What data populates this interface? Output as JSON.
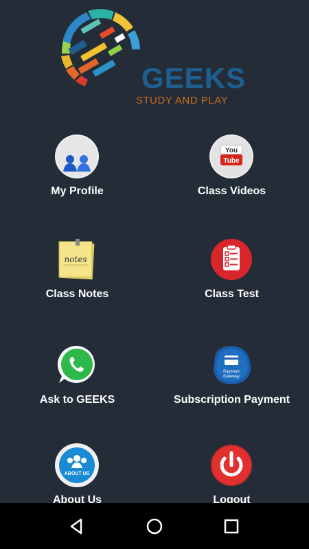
{
  "logo": {
    "word": "GEEKS",
    "tagline": "STUDY AND PLAY"
  },
  "menu": [
    {
      "id": "my-profile",
      "label": "My Profile",
      "icon": "profile-icon"
    },
    {
      "id": "class-videos",
      "label": "Class Videos",
      "icon": "youtube-icon"
    },
    {
      "id": "class-notes",
      "label": "Class Notes",
      "icon": "notes-icon"
    },
    {
      "id": "class-test",
      "label": "Class Test",
      "icon": "clipboard-icon"
    },
    {
      "id": "ask-to-geeks",
      "label": "Ask to GEEKS",
      "icon": "whatsapp-icon"
    },
    {
      "id": "subscription-payment",
      "label": "Subscription Payment",
      "icon": "payment-gateway-icon"
    },
    {
      "id": "about-us",
      "label": "About Us",
      "icon": "about-us-icon"
    },
    {
      "id": "logout",
      "label": "Logout",
      "icon": "power-icon"
    }
  ],
  "icon_text": {
    "youtube_top": "You",
    "youtube_bottom": "Tube",
    "notes": "notes",
    "payment_line1": "Payment",
    "payment_line2": "Gateway",
    "about": "ABOUT US"
  },
  "navbar": {
    "back": "back-icon",
    "home": "home-icon",
    "recents": "recents-icon"
  },
  "colors": {
    "background": "#232c37",
    "navbar": "#000000",
    "logo_blue": "#1f5f8f",
    "logo_orange": "#c76d1f"
  }
}
